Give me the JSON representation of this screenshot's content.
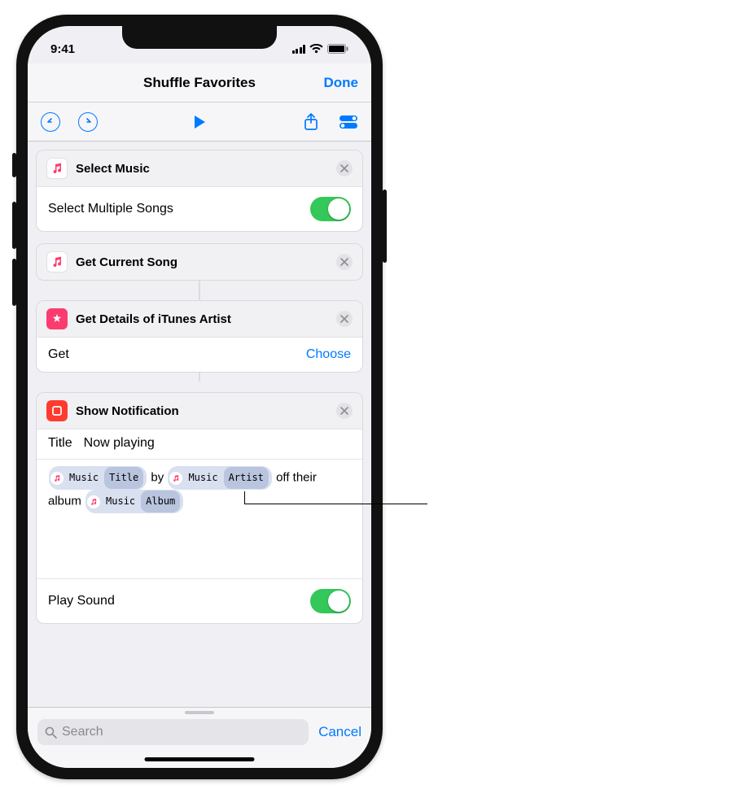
{
  "status": {
    "time": "9:41"
  },
  "nav": {
    "title": "Shuffle Favorites",
    "done": "Done"
  },
  "actions": [
    {
      "id": "select-music",
      "title": "Select Music",
      "icon": "music",
      "rows": [
        {
          "label": "Select Multiple Songs",
          "control": "toggle",
          "value": true
        }
      ]
    },
    {
      "id": "get-current-song",
      "title": "Get Current Song",
      "icon": "music",
      "rows": []
    },
    {
      "id": "get-details-itunes-artist",
      "title": "Get Details of iTunes Artist",
      "icon": "itunes",
      "rows": [
        {
          "label": "Get",
          "control": "choose",
          "choose_label": "Choose"
        }
      ]
    },
    {
      "id": "show-notification",
      "title": "Show Notification",
      "icon": "notification",
      "title_field_label": "Title",
      "title_field_value": "Now playing",
      "message_tokens": [
        {
          "type": "token",
          "main": "Music",
          "sub": "Title"
        },
        {
          "type": "text",
          "text": " by "
        },
        {
          "type": "token",
          "main": "Music",
          "sub": "Artist"
        },
        {
          "type": "text",
          "text": " off their album "
        },
        {
          "type": "token",
          "main": "Music",
          "sub": "Album"
        }
      ],
      "play_sound_label": "Play Sound",
      "play_sound": true
    }
  ],
  "search": {
    "placeholder": "Search",
    "cancel": "Cancel"
  }
}
